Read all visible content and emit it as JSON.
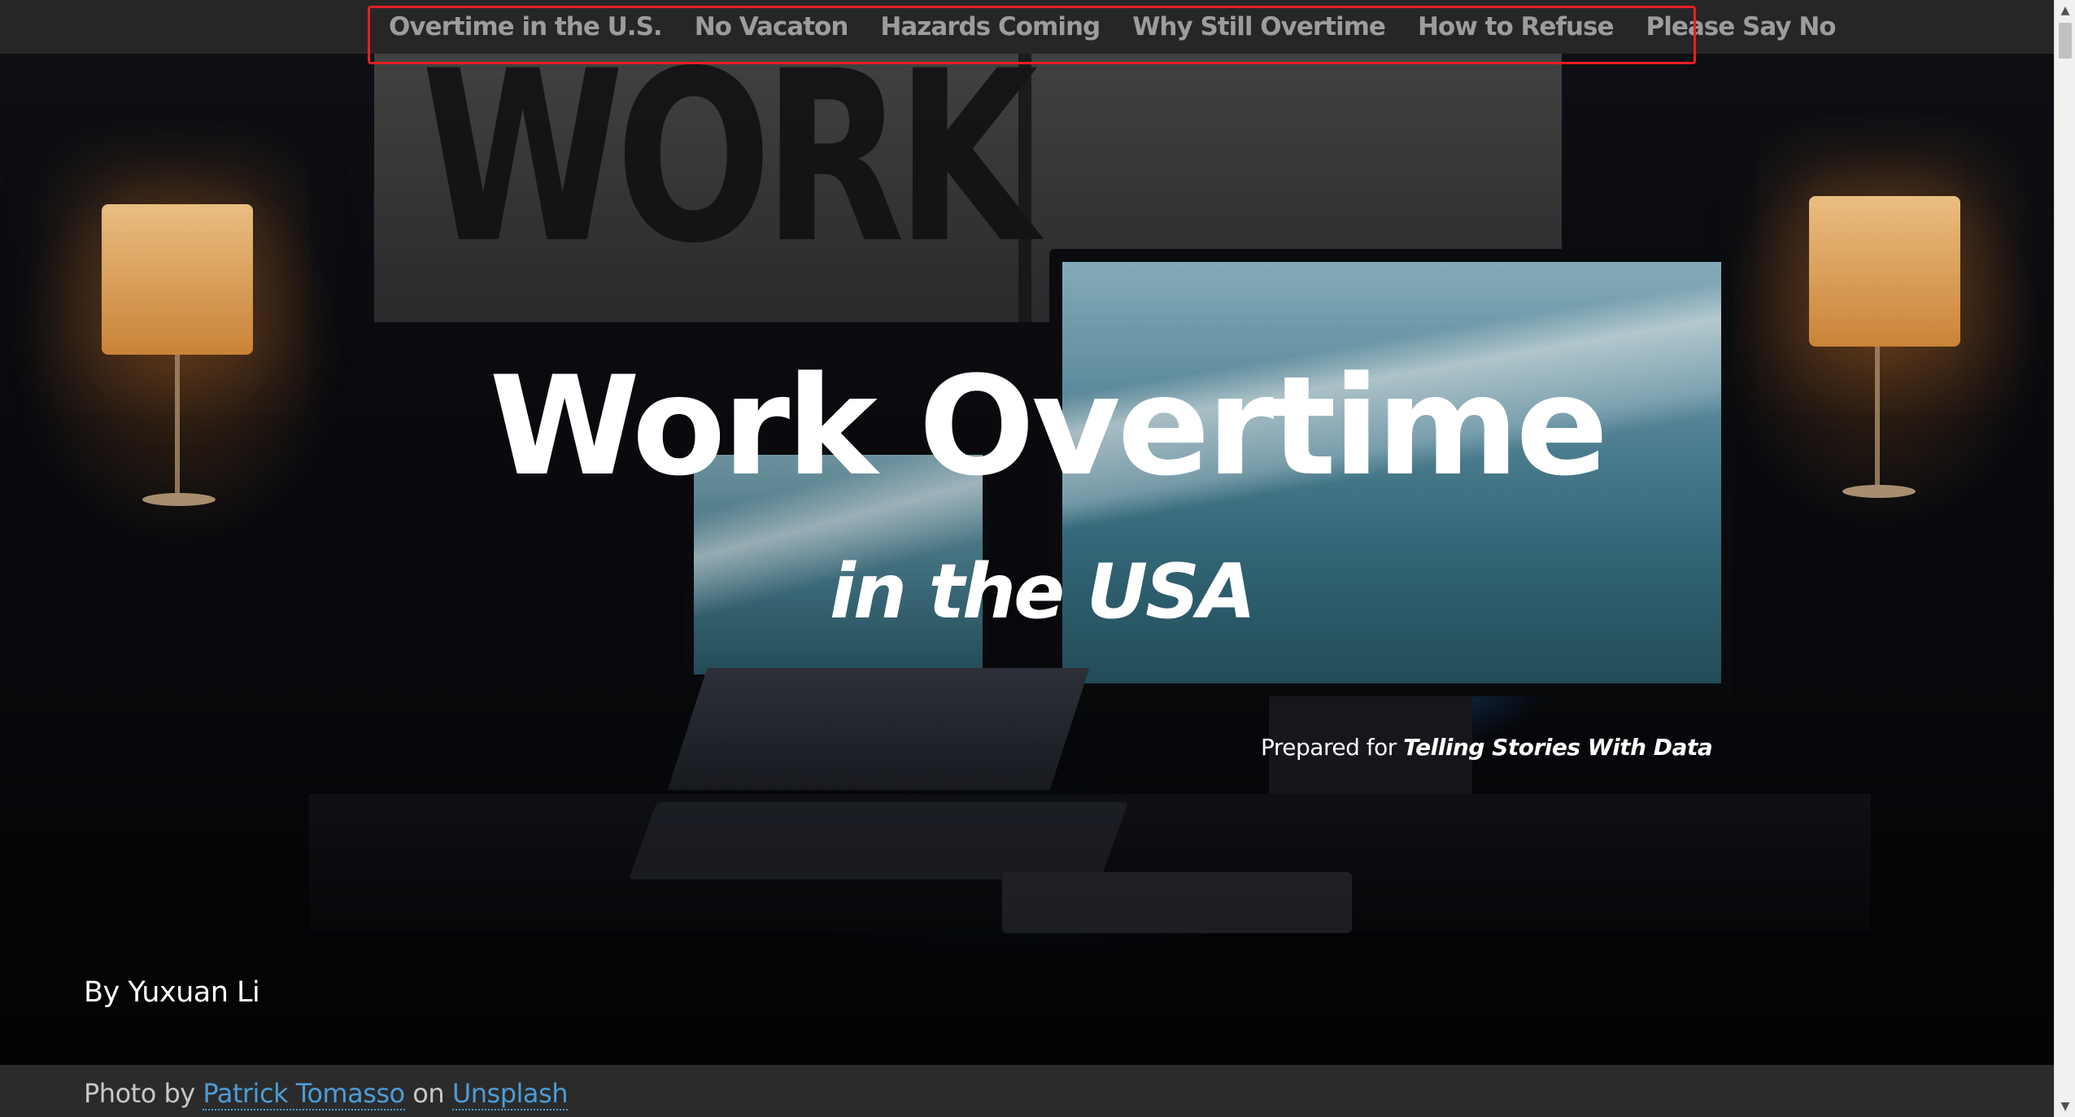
{
  "nav": {
    "items": [
      {
        "label": "Overtime in the U.S."
      },
      {
        "label": "No Vacaton"
      },
      {
        "label": "Hazards Coming"
      },
      {
        "label": "Why Still Overtime"
      },
      {
        "label": "How to Refuse"
      },
      {
        "label": "Please Say No"
      }
    ]
  },
  "hero": {
    "title": "Work Overtime",
    "subtitle": "in the USA",
    "prepared_prefix": "Prepared for ",
    "prepared_emphasis": "Telling Stories With Data",
    "author": "By Yuxuan Li"
  },
  "credit": {
    "prefix": "Photo by ",
    "photographer": "Patrick Tomasso",
    "middle": " on ",
    "site": "Unsplash"
  },
  "colors": {
    "nav_background": "#262626",
    "nav_text": "#9c9c9c",
    "highlight_box": "#e51f25",
    "link": "#4d9cd6"
  },
  "icons": {
    "scroll_up": "▲",
    "scroll_down": "▼"
  }
}
